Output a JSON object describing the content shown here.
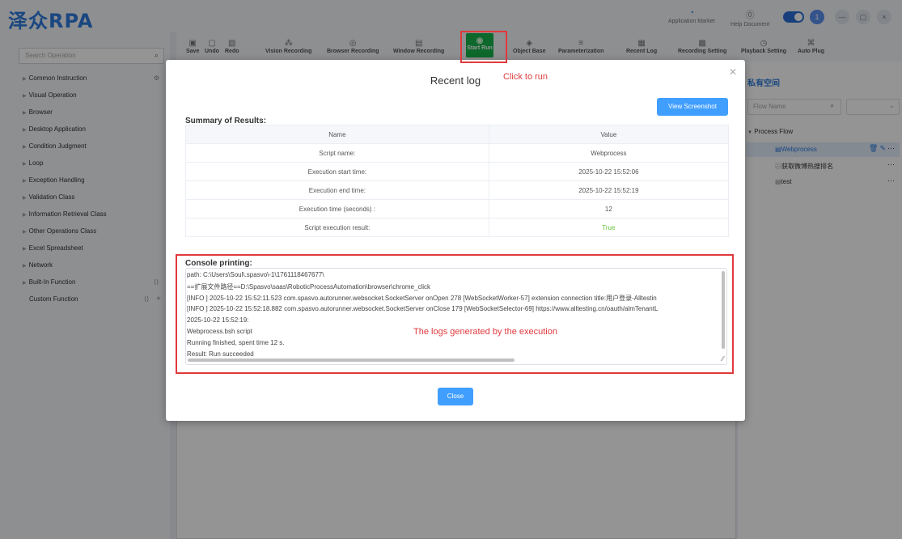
{
  "app": {
    "logo": "泽众RPA"
  },
  "topbar": {
    "app_market": "Application Market",
    "help_doc": "Help Document",
    "avatar": "1",
    "minimize": "—",
    "restore": "▢",
    "close": "×"
  },
  "left": {
    "search_placeholder": "Search Operation",
    "categories": [
      "Common Instruction",
      "Visual Operation",
      "Browser",
      "Desktop Application",
      "Condition Judgment",
      "Loop",
      "Exception Handling",
      "Validation Class",
      "Information Retrieval Class",
      "Other Operations Class",
      "Excel Spreadsheet",
      "Network",
      "Built-In Function",
      "Custom Function"
    ]
  },
  "toolbar": {
    "save": "Save",
    "undo": "Undo",
    "redo": "Redo",
    "vision_recording": "Vision Recording",
    "browser_recording": "Browser Recording",
    "window_recording": "Window Recording",
    "start_run": "Start Run",
    "object_base": "Object Base",
    "parameterization": "Parameterization",
    "recent_log": "Recent Log",
    "recording_setting": "Recording Setting",
    "playback_setting": "Playback Setting",
    "auto_plug": "Auto Plug"
  },
  "right": {
    "title": "私有空间",
    "search_placeholder": "Flow Name",
    "tree_head": "Process Flow",
    "flows": [
      "Webprocess",
      "获取微博热搜排名",
      "test"
    ]
  },
  "dialog": {
    "title": "Recent log",
    "view_screenshot": "View Screenshot",
    "summary_label": "Summary of Results:",
    "col_name": "Name",
    "col_value": "Value",
    "rows": [
      {
        "name": "Script name:",
        "value": "Webprocess"
      },
      {
        "name": "Execution start time:",
        "value": "2025-10-22 15:52:06"
      },
      {
        "name": "Execution end time:",
        "value": "2025-10-22 15:52:19"
      },
      {
        "name": "Execution time (seconds) :",
        "value": "12"
      },
      {
        "name": "Script execution result:",
        "value": "True"
      }
    ],
    "console_label": "Console printing:",
    "console_lines": [
      "path: C:\\Users\\Soul\\.spasvo\\-1\\1761118467677\\",
      "==扩展文件路径==D:\\Spasvo\\saas\\RoboticProcessAutomation\\browser\\chrome_click",
      "[INFO ] 2025-10-22 15:52:11.523 com.spasvo.autorunner.websocket.SocketServer onOpen 278 [WebSocketWorker-57] extension connection title:用户登录-Alltestin",
      "[INFO ] 2025-10-22 15:52:18.882 com.spasvo.autorunner.websocket.SocketServer onClose 179 [WebSocketSelector-69] https://www.alltesting.cn/oauth/almTenantL",
      "2025-10-22 15:52:19:",
      "Webprocess.bsh script",
      "Running finished, spent time 12 s.",
      "Result: Run succeeded"
    ],
    "close_button": "Close"
  },
  "annotations": {
    "click_to_run": "Click to run",
    "logs_note": "The logs generated by the execution"
  },
  "colors": {
    "brand": "#2e7bdc",
    "primary_button": "#409eff",
    "run_green": "#18b34a",
    "annotation_red": "#e0393d",
    "success": "#67c23a"
  }
}
